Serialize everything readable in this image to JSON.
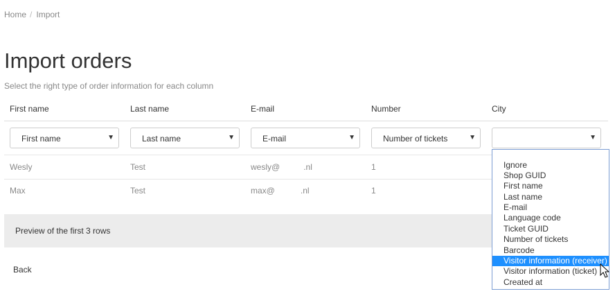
{
  "breadcrumb": {
    "home": "Home",
    "separator": "/",
    "current": "Import"
  },
  "page": {
    "title": "Import orders",
    "subtitle": "Select the right type of order information for each column"
  },
  "columns": [
    {
      "header": "First name",
      "selected": "First name"
    },
    {
      "header": "Last name",
      "selected": "Last name"
    },
    {
      "header": "E-mail",
      "selected": "E-mail"
    },
    {
      "header": "Number",
      "selected": "Number of tickets"
    },
    {
      "header": "City",
      "selected": ""
    }
  ],
  "rows": [
    {
      "first": "Wesly",
      "last": "Test",
      "email_user": "wesly@",
      "email_domain": ".nl",
      "number": "1"
    },
    {
      "first": "Max",
      "last": "Test",
      "email_user": "max@",
      "email_domain": ".nl",
      "number": "1"
    }
  ],
  "preview": {
    "text": "Preview of the first 3 rows"
  },
  "back_label": "Back",
  "dropdown": {
    "options": [
      "Ignore",
      "Shop GUID",
      "First name",
      "Last name",
      "E-mail",
      "Language code",
      "Ticket GUID",
      "Number of tickets",
      "Barcode",
      "Visitor information (receiver)",
      "Visitor information (ticket)",
      "Created at"
    ],
    "highlighted": "Visitor information (receiver)"
  },
  "colors": {
    "highlight": "#1e90ff",
    "preview_bg": "#ececec",
    "dropdown_border": "#7a9cd3"
  }
}
